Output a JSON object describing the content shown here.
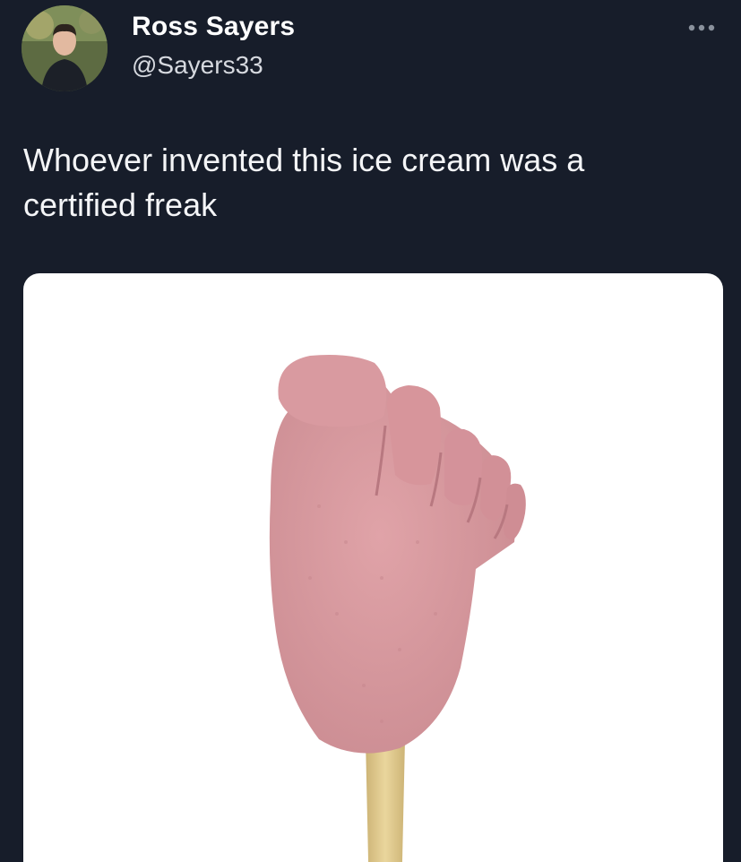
{
  "tweet": {
    "author_name": "Ross Sayers",
    "author_handle": "@Sayers33",
    "text": "Whoever invented this ice cream was a certified freak",
    "avatar_icon": "user-avatar-photo",
    "more_icon": "more-options-icon",
    "media_description_icon": "foot-shaped-ice-cream-image"
  },
  "colors": {
    "background": "#171d2a",
    "text": "#ffffff",
    "handle": "#d6d9df",
    "media_background": "#ffffff",
    "ice_cream": "#d99aa0",
    "stick": "#e3cc8f"
  }
}
